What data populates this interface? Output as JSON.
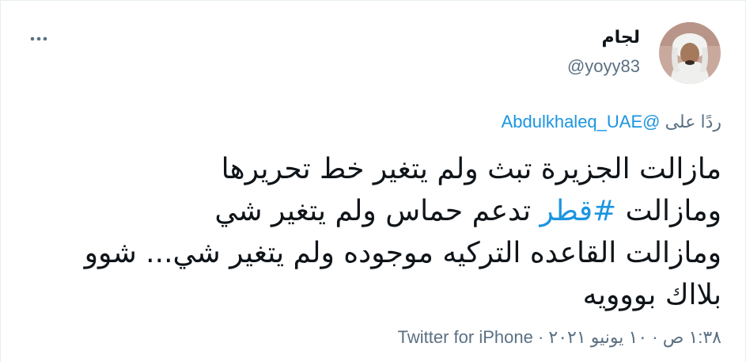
{
  "user": {
    "name": "لجام",
    "handle": "@yoyy83",
    "avatar_icon": "profile-photo"
  },
  "reply": {
    "prefix": "ردًا على ",
    "mention": "@Abdulkhaleq_UAE"
  },
  "tweet": {
    "line1": "مازالت الجزيرة تبث ولم يتغير خط تحريرها",
    "line2_start": "ومازالت ",
    "hashtag": "#قطر",
    "line2_end": " تدعم حماس ولم يتغير شي",
    "line3": "ومازالت القاعده التركيه موجوده ولم يتغير شي... شوو",
    "line4": "بلااك بووويه"
  },
  "meta": {
    "time": "١:٣٨ ص",
    "separator": " · ",
    "date": "١٠ يونيو ٢٠٢١",
    "separator2": " · ",
    "source": "Twitter for iPhone"
  },
  "colors": {
    "link": "#1b95e0",
    "secondary": "#5b7083",
    "text": "#0f1419"
  },
  "icons": {
    "more": "more-horizontal-icon"
  }
}
